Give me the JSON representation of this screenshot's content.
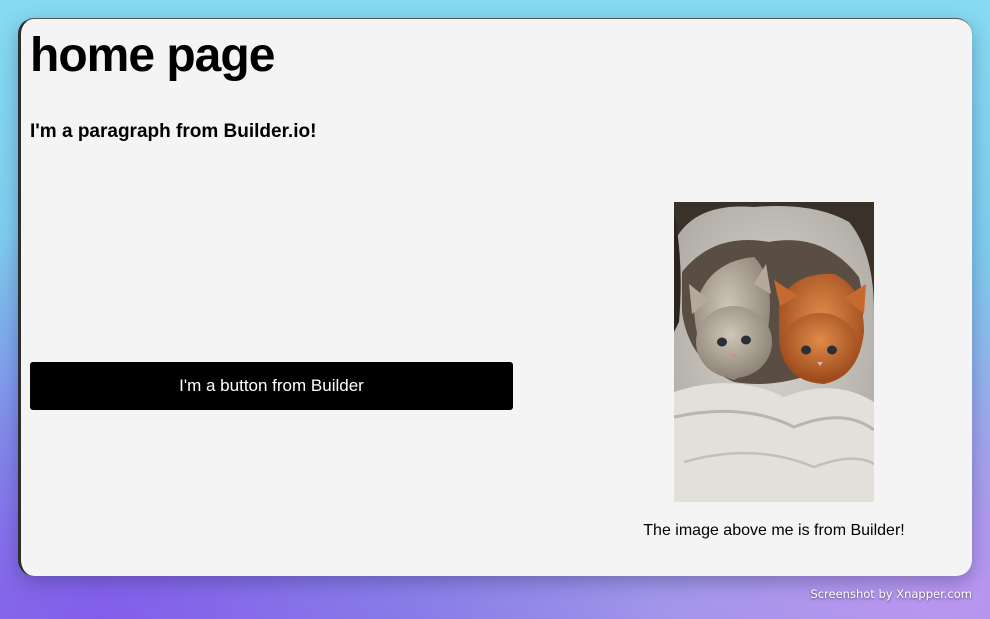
{
  "page": {
    "title": "home page",
    "paragraph": "I'm a paragraph from Builder.io!",
    "button_label": "I'm a button from Builder",
    "image_alt": "Two kittens in a blanket",
    "image_caption": "The image above me is from Builder!"
  },
  "footer": {
    "watermark": "Screenshot by Xnapper.com"
  },
  "colors": {
    "page_bg": "#f4f4f4",
    "button_bg": "#000000",
    "button_text": "#ffffff"
  }
}
